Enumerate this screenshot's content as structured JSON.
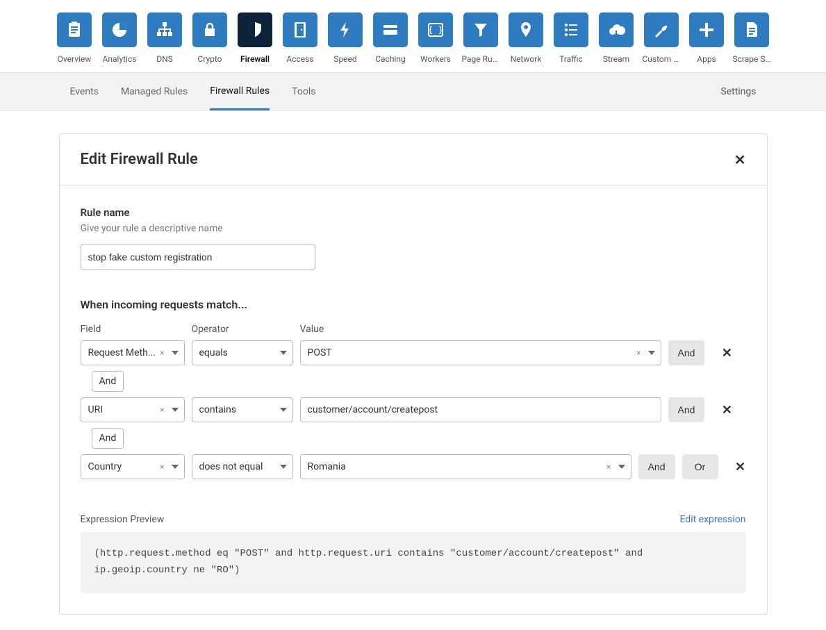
{
  "nav": [
    {
      "key": "overview",
      "label": "Overview",
      "icon": "clipboard"
    },
    {
      "key": "analytics",
      "label": "Analytics",
      "icon": "pie"
    },
    {
      "key": "dns",
      "label": "DNS",
      "icon": "sitemap"
    },
    {
      "key": "crypto",
      "label": "Crypto",
      "icon": "lock"
    },
    {
      "key": "firewall",
      "label": "Firewall",
      "icon": "shield",
      "active": true
    },
    {
      "key": "access",
      "label": "Access",
      "icon": "door"
    },
    {
      "key": "speed",
      "label": "Speed",
      "icon": "bolt"
    },
    {
      "key": "caching",
      "label": "Caching",
      "icon": "card"
    },
    {
      "key": "workers",
      "label": "Workers",
      "icon": "braces"
    },
    {
      "key": "pagerules",
      "label": "Page Rules",
      "icon": "funnel"
    },
    {
      "key": "network",
      "label": "Network",
      "icon": "pin"
    },
    {
      "key": "traffic",
      "label": "Traffic",
      "icon": "list"
    },
    {
      "key": "stream",
      "label": "Stream",
      "icon": "cloud"
    },
    {
      "key": "customp",
      "label": "Custom P...",
      "icon": "wrench"
    },
    {
      "key": "apps",
      "label": "Apps",
      "icon": "plus"
    },
    {
      "key": "scrape",
      "label": "Scrape Shi...",
      "icon": "doc"
    }
  ],
  "subnav": {
    "tabs": [
      {
        "key": "events",
        "label": "Events"
      },
      {
        "key": "managed",
        "label": "Managed Rules"
      },
      {
        "key": "firewall",
        "label": "Firewall Rules",
        "active": true
      },
      {
        "key": "tools",
        "label": "Tools"
      }
    ],
    "settings": "Settings"
  },
  "panel": {
    "title": "Edit Firewall Rule",
    "rule_name_label": "Rule name",
    "rule_name_help": "Give your rule a descriptive name",
    "rule_name_value": "stop fake custom registration",
    "match_heading": "When incoming requests match...",
    "col_field": "Field",
    "col_operator": "Operator",
    "col_value": "Value",
    "rows": [
      {
        "field": "Request Meth...",
        "op": "equals",
        "value": "POST",
        "clearVal": true,
        "hasCaret": true,
        "and": "And"
      },
      {
        "field": "URI",
        "op": "contains",
        "value": "customer/account/createpost",
        "clearVal": false,
        "hasCaret": false,
        "and": "And"
      },
      {
        "field": "Country",
        "op": "does not equal",
        "value": "Romania",
        "clearVal": true,
        "hasCaret": true,
        "and": "And",
        "or": "Or"
      }
    ],
    "join_label": "And",
    "expr_label": "Expression Preview",
    "expr_link": "Edit expression",
    "expression": "(http.request.method eq \"POST\" and http.request.uri contains \"customer/account/createpost\" and ip.geoip.country ne \"RO\")"
  }
}
